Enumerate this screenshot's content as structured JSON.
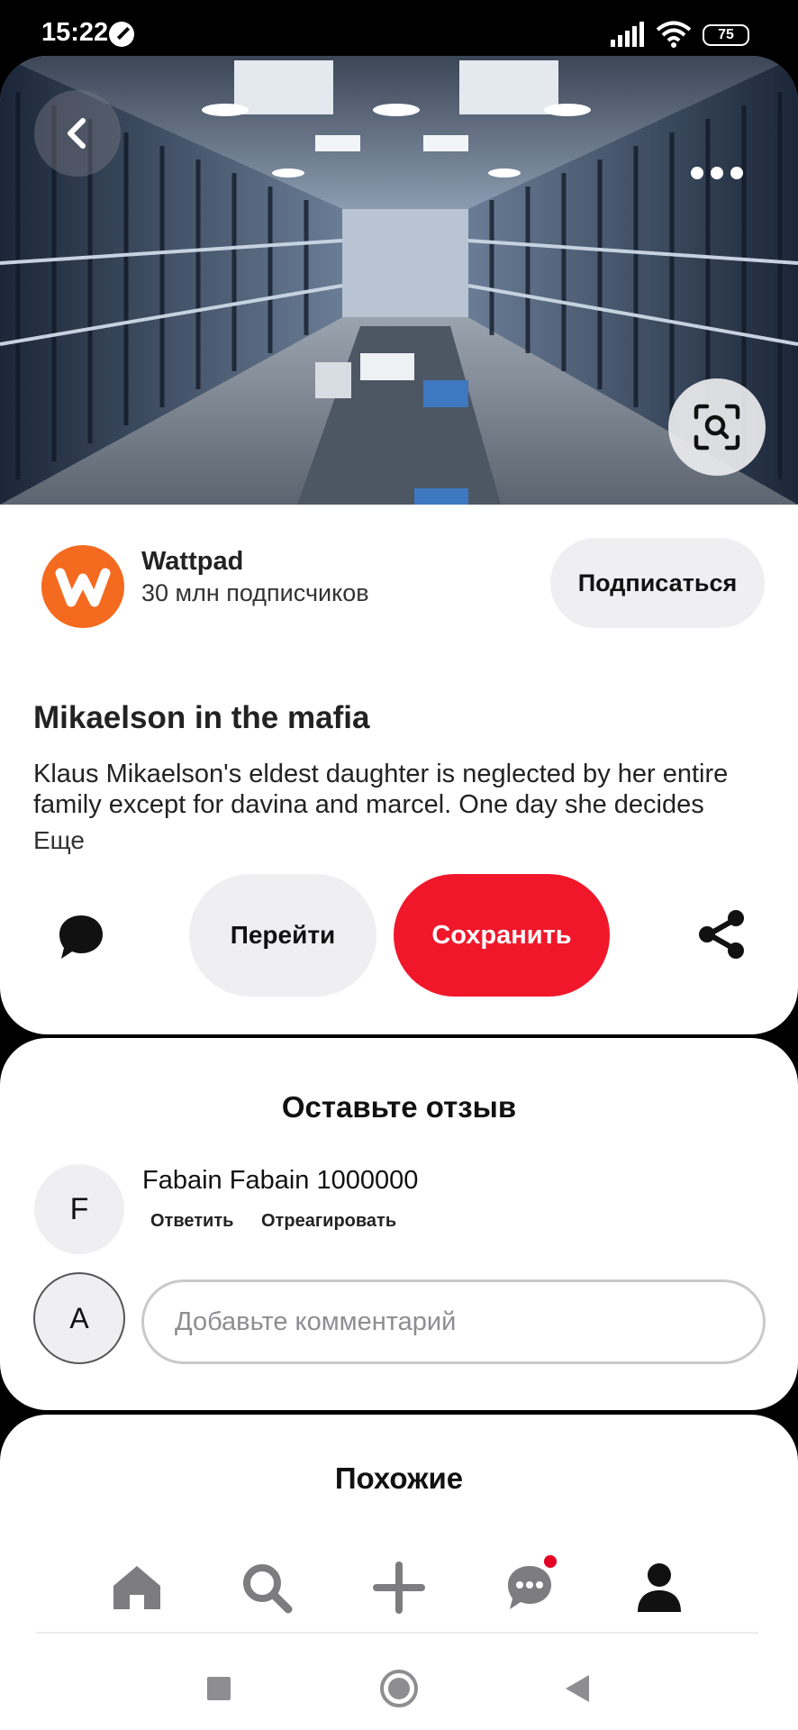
{
  "status_bar": {
    "time": "15:22",
    "battery": "75",
    "icons": [
      "do-not-disturb-icon",
      "signal-icon",
      "wifi-icon",
      "battery-icon"
    ]
  },
  "hero": {
    "icons": [
      "back-icon",
      "more-icon",
      "visual-search-icon"
    ]
  },
  "creator": {
    "name": "Wattpad",
    "followers": "30 млн подписчиков",
    "follow_label": "Подписаться",
    "logo_letter": "w",
    "logo_color": "#f46a1f"
  },
  "pin": {
    "title": "Mikaelson in the mafia",
    "description": "Klaus Mikaelson's eldest daughter is neglected by her entire family except for davina and marcel. One day she decides",
    "more_label": "Еще"
  },
  "actions": {
    "visit_label": "Перейти",
    "save_label": "Сохранить",
    "save_color": "#f0172b"
  },
  "comments": {
    "heading": "Оставьте отзыв",
    "items": [
      {
        "avatar": "F",
        "text": "Fabain Fabain 1000000",
        "reply_label": "Ответить",
        "react_label": "Отреагировать"
      }
    ],
    "user_avatar": "A",
    "input_placeholder": "Добавьте комментарий"
  },
  "similar": {
    "heading": "Похожие"
  },
  "bottom_nav": {
    "items": [
      "home-icon",
      "search-icon",
      "add-icon",
      "messages-icon",
      "profile-icon"
    ],
    "badge_color": "#e60023"
  },
  "system_nav": {
    "items": [
      "recents-icon",
      "home-circle-icon",
      "back-triangle-icon"
    ]
  }
}
